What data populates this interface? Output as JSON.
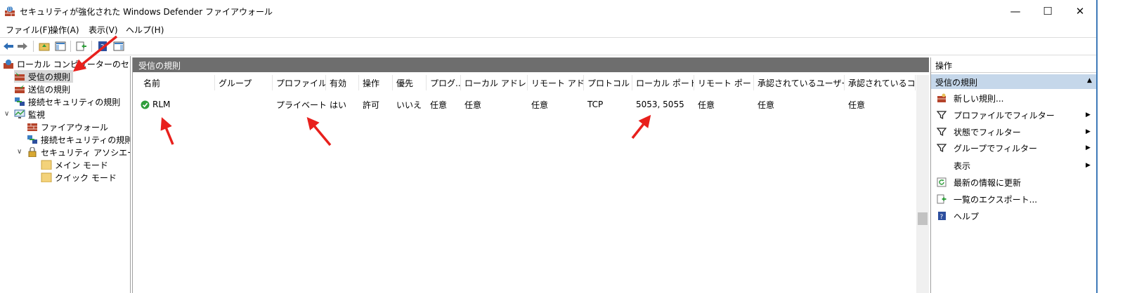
{
  "window": {
    "title": "セキュリティが強化された Windows Defender ファイアウォール",
    "min_glyph": "—",
    "max_glyph": "☐",
    "close_glyph": "✕"
  },
  "menu": [
    "ファイル(F)",
    "操作(A)",
    "表示(V)",
    "ヘルプ(H)"
  ],
  "tree": {
    "root": "ローカル コンピューターのセキュリティ",
    "inbound": "受信の規則",
    "outbound": "送信の規則",
    "connection_security": "接続セキュリティの規則",
    "monitoring": "監視",
    "firewall": "ファイアウォール",
    "monitor_connection_security": "接続セキュリティの規則",
    "security_associations": "セキュリティ アソシエーション",
    "main_mode": "メイン モード",
    "quick_mode": "クイック モード"
  },
  "center": {
    "title": "受信の規則",
    "columns": [
      "名前",
      "グループ",
      "プロファイル",
      "有効",
      "操作",
      "優先",
      "プログ...",
      "ローカル アドレス",
      "リモート アド...",
      "プロトコル",
      "ローカル ポート",
      "リモート ポート",
      "承認されているユーザー",
      "承認されているコンピ"
    ],
    "rows": [
      [
        "RLM",
        "",
        "プライベート",
        "はい",
        "許可",
        "いいえ",
        "任意",
        "任意",
        "任意",
        "TCP",
        "5053, 5055",
        "任意",
        "任意",
        "任意"
      ]
    ]
  },
  "actions": {
    "title": "操作",
    "section": "受信の規則",
    "items": [
      "新しい規則...",
      "プロファイルでフィルター",
      "状態でフィルター",
      "グループでフィルター",
      "表示",
      "最新の情報に更新",
      "一覧のエクスポート...",
      "ヘルプ"
    ]
  },
  "colors": {
    "header_bg": "#6e6e6e",
    "selection_bg": "#d9d9d9",
    "action_section_bg": "#c5d7ea",
    "arrow": "#e8201c",
    "enabled_check": "#2f9e3b"
  }
}
